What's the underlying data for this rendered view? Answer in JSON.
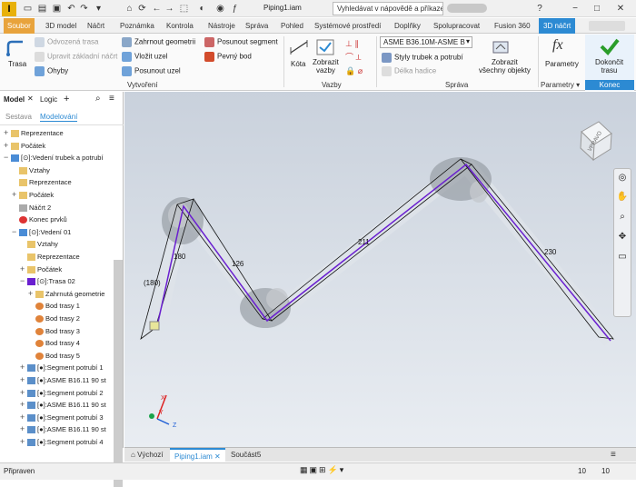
{
  "titlebar": {
    "logo_text": "I",
    "doc_title": "Piping1.iam",
    "help_placeholder": "Vyhledávat v nápovědě a příkaze"
  },
  "tabs": [
    "Soubor",
    "3D model",
    "Náčrt",
    "Poznámka",
    "Kontrola",
    "Nástroje",
    "Správa",
    "Pohled",
    "Systémové prostředí",
    "Doplňky",
    "Spolupracovat",
    "Fusion 360",
    "3D náčrt"
  ],
  "ribbon": {
    "trasa": "Trasa",
    "odvozena_trasa": "Odvozená trasa",
    "upravit_zakladni_nacrt": "Upravit základní náčrt",
    "ohyby": "Ohyby",
    "zahrnout_geometrii": "Zahrnout geometrii",
    "vlozit_uzel": "Vložit uzel",
    "posunout_uzel": "Posunout uzel",
    "posunout_segment": "Posunout segment",
    "pevny_bod": "Pevný bod",
    "kota": "Kóta",
    "zobrazit_vazby_1": "Zobrazit",
    "zobrazit_vazby_2": "vazby",
    "style_select": "ASME B36.10M-ASME B",
    "styly_trubek": "Styly trubek a potrubí",
    "delka_hadice": "Délka hadice",
    "zobrazit_vsechny_1": "Zobrazit",
    "zobrazit_vsechny_2": "všechny objekty",
    "parametry": "Parametry",
    "dokoncit_1": "Dokončit",
    "dokoncit_2": "trasu",
    "panel_vytvoreni": "Vytvoření",
    "panel_vazby": "Vazby",
    "panel_sprava": "Správa",
    "panel_parametry": "Parametry",
    "panel_konec": "Konec",
    "fx_symbol": "fx"
  },
  "browser": {
    "tab_model": "Model",
    "tab_logic": "Logic",
    "sub_sestava": "Sestava",
    "sub_modelovani": "Modelování",
    "items": [
      {
        "label": "Reprezentace",
        "indent": 0,
        "exp": "+",
        "icon": "folder"
      },
      {
        "label": "Počátek",
        "indent": 0,
        "exp": "+",
        "icon": "folder"
      },
      {
        "label": "[⊙]:Vedení trubek a potrubí",
        "indent": 0,
        "exp": "−",
        "icon": "assembly"
      },
      {
        "label": "Vztahy",
        "indent": 1,
        "exp": "",
        "icon": "folder"
      },
      {
        "label": "Reprezentace",
        "indent": 1,
        "exp": "",
        "icon": "folder"
      },
      {
        "label": "Počátek",
        "indent": 1,
        "exp": "+",
        "icon": "folder"
      },
      {
        "label": "Náčrt 2",
        "indent": 1,
        "exp": "",
        "icon": "sketch"
      },
      {
        "label": "Konec prvků",
        "indent": 1,
        "exp": "",
        "icon": "end"
      },
      {
        "label": "[⊙]:Vedení 01",
        "indent": 1,
        "exp": "−",
        "icon": "assembly"
      },
      {
        "label": "Vztahy",
        "indent": 2,
        "exp": "",
        "icon": "folder"
      },
      {
        "label": "Reprezentace",
        "indent": 2,
        "exp": "",
        "icon": "folder"
      },
      {
        "label": "Počátek",
        "indent": 2,
        "exp": "+",
        "icon": "folder"
      },
      {
        "label": "[⊙]:Trasa 02",
        "indent": 2,
        "exp": "−",
        "icon": "route"
      },
      {
        "label": "Zahrnutá geometrie",
        "indent": 3,
        "exp": "+",
        "icon": "folder"
      },
      {
        "label": "Bod trasy 1",
        "indent": 3,
        "exp": "",
        "icon": "point"
      },
      {
        "label": "Bod trasy 2",
        "indent": 3,
        "exp": "",
        "icon": "point"
      },
      {
        "label": "Bod trasy 3",
        "indent": 3,
        "exp": "",
        "icon": "point"
      },
      {
        "label": "Bod trasy 4",
        "indent": 3,
        "exp": "",
        "icon": "point"
      },
      {
        "label": "Bod trasy 5",
        "indent": 3,
        "exp": "",
        "icon": "point"
      },
      {
        "label": "[●]:Segment potrubí 1",
        "indent": 2,
        "exp": "+",
        "icon": "pipe"
      },
      {
        "label": "[●]:ASME B16.11 90 st",
        "indent": 2,
        "exp": "+",
        "icon": "pipe"
      },
      {
        "label": "[●]:Segment potrubí 2",
        "indent": 2,
        "exp": "+",
        "icon": "pipe"
      },
      {
        "label": "[●]:ASME B16.11 90 st",
        "indent": 2,
        "exp": "+",
        "icon": "pipe"
      },
      {
        "label": "[●]:Segment potrubí 3",
        "indent": 2,
        "exp": "+",
        "icon": "pipe"
      },
      {
        "label": "[●]:ASME B16.11 90 st",
        "indent": 2,
        "exp": "+",
        "icon": "pipe"
      },
      {
        "label": "[●]:Segment potrubí 4",
        "indent": 2,
        "exp": "+",
        "icon": "pipe"
      }
    ]
  },
  "viewport": {
    "dims": [
      "180",
      "(180)",
      "126",
      "211",
      "230"
    ],
    "viewcube_label": "VPRAVO",
    "axis_x": "X",
    "axis_y": "Y",
    "axis_z": "Z"
  },
  "doctabs": {
    "home": "Výchozí",
    "active": "Piping1.iam",
    "other": "Součást5"
  },
  "status": {
    "text": "Připraven",
    "count1": "10",
    "count2": "10"
  },
  "colors": {
    "accent": "#2c8ad3",
    "file_tab": "#e8a33c",
    "route": "#6a1fd0"
  }
}
